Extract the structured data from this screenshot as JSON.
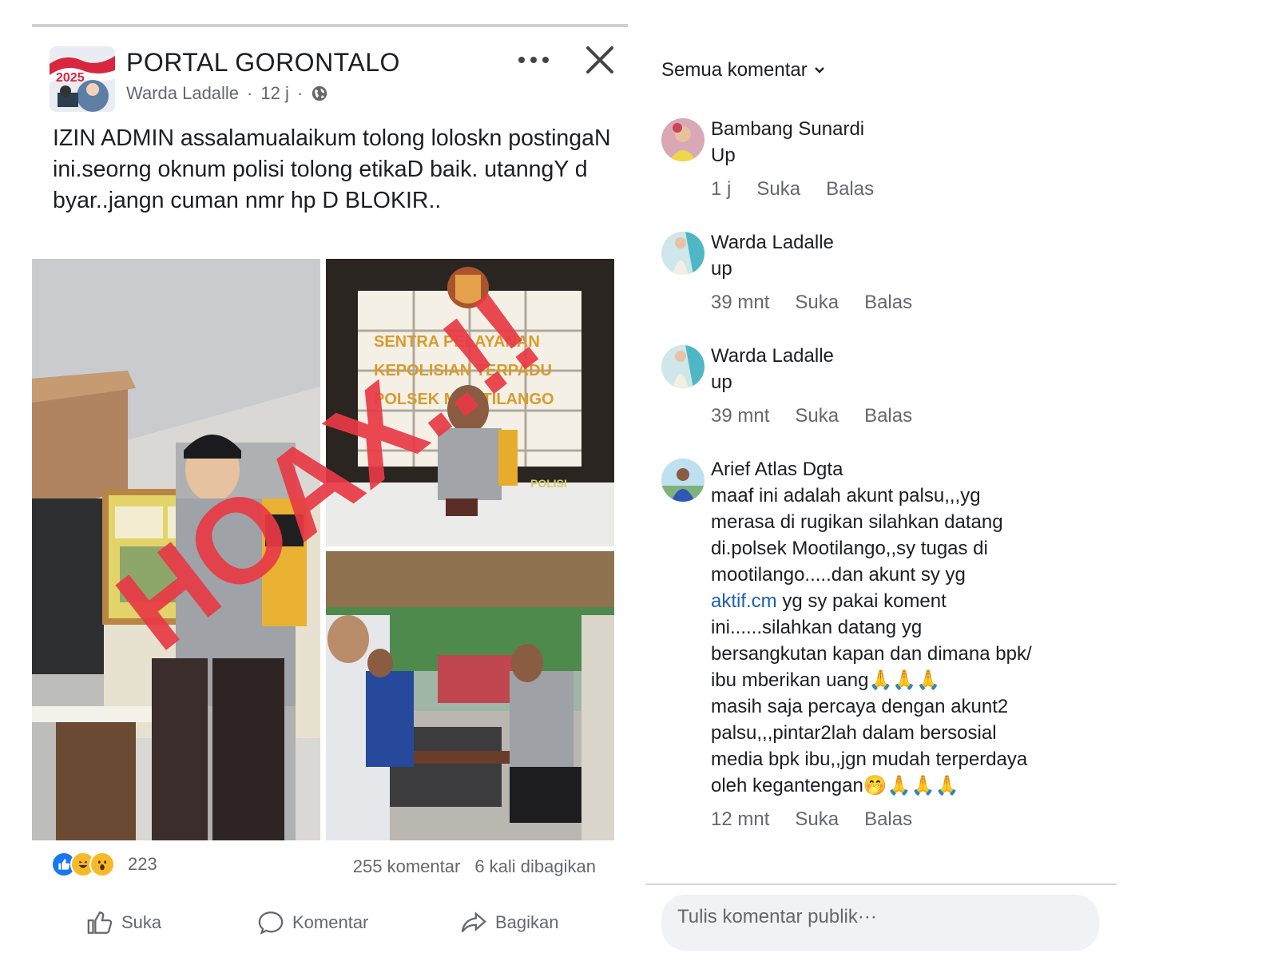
{
  "post": {
    "page_name": "PORTAL GORONTALO",
    "author": "Warda Ladalle",
    "time": "12 j",
    "separator": "·",
    "text": "IZIN ADMIN assalamualaikum  tolong loloskn postingaN ini.seorng oknum polisi tolong etikaD baik. utanngY d byar..jangn cuman nmr hp D BLOKIR..",
    "overlay_stamp": "HOAX..!!",
    "photo_signs": {
      "wall_line1": "SENTRA PELAYANAN",
      "wall_line2": "KEPOLISIAN TERPADU",
      "wall_line3": "POLSEK MOOTILANGO",
      "armband": "POLISI"
    },
    "reaction_count": "223",
    "comment_count": "255 komentar",
    "share_count": "6 kali dibagikan",
    "actions": {
      "like": "Suka",
      "comment": "Komentar",
      "share": "Bagikan"
    }
  },
  "comments_panel": {
    "filter_label": "Semua komentar",
    "comments": [
      {
        "name": "Bambang Sunardi",
        "text": "Up",
        "time": "1 j",
        "like": "Suka",
        "reply": "Balas"
      },
      {
        "name": "Warda Ladalle",
        "text": "up",
        "time": "39 mnt",
        "like": "Suka",
        "reply": "Balas"
      },
      {
        "name": "Warda Ladalle",
        "text": "up",
        "time": "39 mnt",
        "like": "Suka",
        "reply": "Balas"
      },
      {
        "name": "Arief Atlas Dgta",
        "text_before_link": "maaf ini adalah akunt palsu,,,yg\nmerasa di rugikan silahkan datang\ndi.polsek Mootilango,,sy tugas di\nmootilango.....dan akunt sy yg\n",
        "link": "aktif.cm",
        "text_after_link": " yg sy pakai koment\nini......silahkan datang yg\nbersangkutan kapan dan dimana bpk/\nibu mberikan uang🙏🙏🙏\nmasih saja percaya dengan akunt2\npalsu,,,pintar2lah dalam bersosial\nmedia bpk ibu,,jgn mudah terperdaya\noleh kegantengan🤭🙏🙏🙏",
        "time": "12 mnt",
        "like": "Suka",
        "reply": "Balas"
      }
    ],
    "input_placeholder": "Tulis komentar publik···"
  },
  "colors": {
    "hoax_red": "#e83a45",
    "link_blue": "#1a5fb4",
    "like_blue": "#1877f2",
    "muted_text": "#65676b"
  },
  "icons": [
    "page-avatar",
    "globe-icon",
    "more-icon",
    "close-icon",
    "like-reaction-icon",
    "haha-reaction-icon",
    "wow-reaction-icon",
    "thumbs-up-icon",
    "comment-icon",
    "share-icon",
    "chevron-down-icon"
  ]
}
